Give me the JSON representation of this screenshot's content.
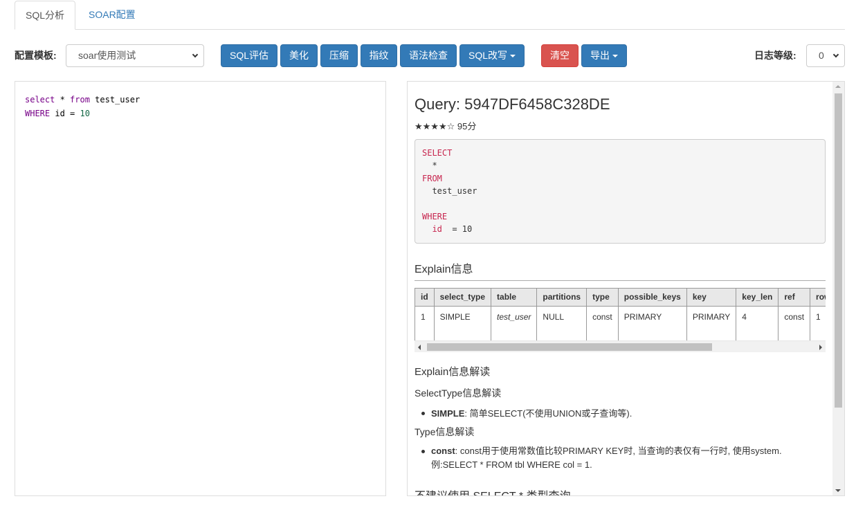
{
  "tabs": [
    {
      "label": "SQL分析",
      "active": true
    },
    {
      "label": "SOAR配置",
      "active": false
    }
  ],
  "toolbar": {
    "template_label": "配置模板:",
    "template_value": "soar使用测试",
    "buttons": {
      "evaluate": "SQL评估",
      "beautify": "美化",
      "compress": "压缩",
      "fingerprint": "指纹",
      "syntax": "语法检查",
      "rewrite": "SQL改写",
      "clear": "清空",
      "export": "导出"
    },
    "log_level_label": "日志等级:",
    "log_level_value": "0"
  },
  "editor": {
    "line1": {
      "kw1": "select",
      "mid": " * ",
      "kw2": "from",
      "rest": " test_user"
    },
    "line2": {
      "kw1": "WHERE",
      "mid": " id = ",
      "num": "10"
    }
  },
  "result": {
    "query_title": "Query: 5947DF6458C328DE",
    "stars": "★★★★☆",
    "score": "95分",
    "formatted_sql": {
      "select": "SELECT",
      "star": "  *",
      "from": "FROM",
      "table": "  test_user",
      "where": "WHERE",
      "col": "id",
      "cond": "  = 10"
    },
    "explain_heading": "Explain信息",
    "explain_table": {
      "headers": [
        "id",
        "select_type",
        "table",
        "partitions",
        "type",
        "possible_keys",
        "key",
        "key_len",
        "ref",
        "rows"
      ],
      "rows": [
        [
          "1",
          "SIMPLE",
          "test_user",
          "NULL",
          "const",
          "PRIMARY",
          "PRIMARY",
          "4",
          "const",
          "1"
        ]
      ]
    },
    "interpretation_heading": "Explain信息解读",
    "select_type_heading": "SelectType信息解读",
    "select_type_item": {
      "term": "SIMPLE",
      "desc": ": 简单SELECT(不使用UNION或子查询等)."
    },
    "type_heading": "Type信息解读",
    "type_item": {
      "term": "const",
      "desc": ": const用于使用常数值比较PRIMARY KEY时, 当查询的表仅有一行时, 使用system. 例:SELECT * FROM tbl WHERE col = 1."
    },
    "no_select_heading": "不建议使用 SELECT * 类型查询"
  }
}
